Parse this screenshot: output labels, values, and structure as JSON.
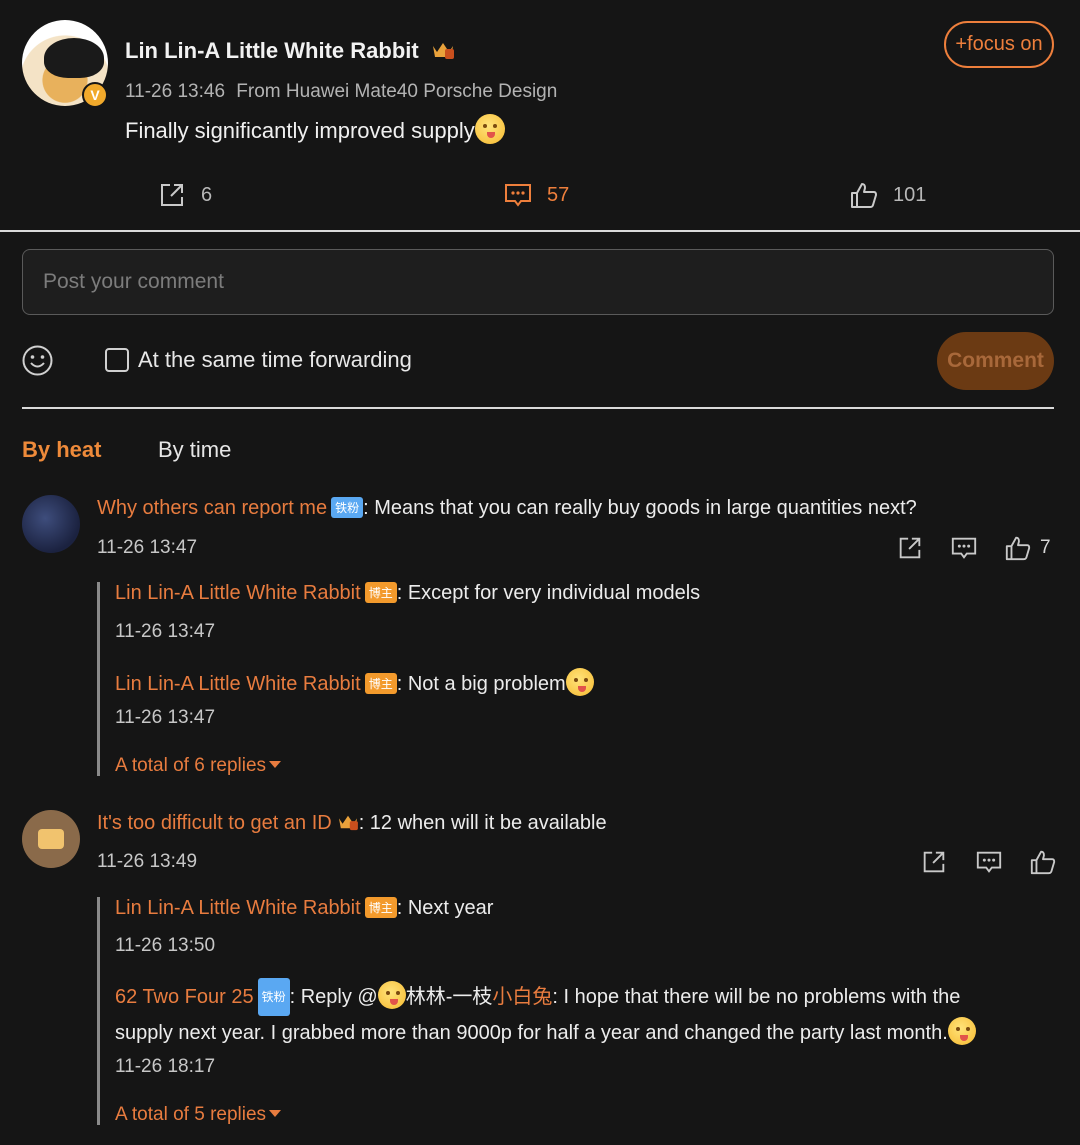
{
  "post": {
    "author": "Lin Lin-A Little White Rabbit",
    "time": "11-26 13:46",
    "source": "From Huawei Mate40 Porsche Design",
    "text": "Finally significantly improved supply",
    "focus_label": "+focus on",
    "forward_count": "6",
    "comment_count": "57",
    "like_count": "101"
  },
  "composer": {
    "placeholder": "Post your comment",
    "forward_label": "At the same time forwarding",
    "submit_label": "Comment"
  },
  "tabs": {
    "by_heat": "By heat",
    "by_time": "By time"
  },
  "comments": [
    {
      "user": "Why others can report me",
      "tag": "铁粉",
      "text": ": Means that you can really buy goods in large quantities next?",
      "time": "11-26 13:47",
      "like_count": "7",
      "replies": [
        {
          "user": "Lin Lin-A Little White Rabbit",
          "tag": "博主",
          "text": ": Except for very individual models",
          "time": "11-26 13:47"
        },
        {
          "user": "Lin Lin-A Little White Rabbit",
          "tag": "博主",
          "text": ": Not a big problem",
          "time": "11-26 13:47"
        }
      ],
      "total_replies": "A total of 6 replies"
    },
    {
      "user": "It's too difficult to get an ID",
      "text": ": 12 when will it be available",
      "time": "11-26 13:49",
      "replies": [
        {
          "user": "Lin Lin-A Little White Rabbit",
          "tag": "博主",
          "text": ": Next year",
          "time": "11-26 13:50"
        },
        {
          "user": "62 Two Four 25",
          "tag": "铁粉",
          "reply_prefix": ": Reply @",
          "mention_a": "林林-一枝",
          "mention_b": "小白兔",
          "text": ": I hope that there will be no problems with the supply next year. I grabbed more than 9000p for half a year and changed the party last month.",
          "time": "11-26 18:17"
        }
      ],
      "total_replies": "A total of 5 replies"
    }
  ],
  "colors": {
    "accent": "#ee7f3c",
    "background": "#151515",
    "fan_tag": "#5aa8f2",
    "host_tag": "#f39a2c"
  }
}
